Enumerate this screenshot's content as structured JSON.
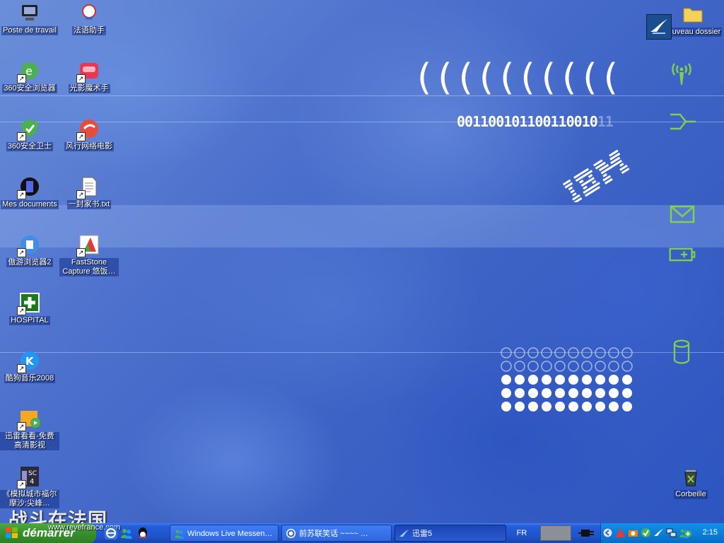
{
  "desktop": {
    "icons_left": [
      {
        "label": "Poste de travail",
        "icon": "my-computer-icon"
      },
      {
        "label": "法语助手",
        "icon": "french-assistant-icon"
      },
      {
        "label": "360安全浏览器",
        "icon": "360-browser-icon"
      },
      {
        "label": "光影魔术手",
        "icon": "photo-magic-icon"
      },
      {
        "label": "360安全卫士",
        "icon": "360-security-icon"
      },
      {
        "label": "风行网络电影",
        "icon": "funshion-icon"
      },
      {
        "label": "Mes documents",
        "icon": "my-documents-icon"
      },
      {
        "label": "一封家书.txt",
        "icon": "text-file-icon"
      },
      {
        "label": "傲游浏览器2",
        "icon": "maxthon-icon"
      },
      {
        "label": "FastStone Capture 悠饭…",
        "icon": "faststone-icon"
      },
      {
        "label": "HOSPITAL",
        "icon": "hospital-icon"
      },
      {
        "label": "酷狗音乐2008",
        "icon": "kugou-icon"
      },
      {
        "label": "迅雷看看-免费高清影视",
        "icon": "xunlei-kankan-icon"
      },
      {
        "label": "《模拟城市福尔摩沙:尖峰…",
        "icon": "simcity-icon"
      }
    ],
    "icons_right": [
      {
        "label": "uveau dossier",
        "icon": "folder-icon"
      },
      {
        "label": "Corbeille",
        "icon": "recycle-bin-icon"
      }
    ],
    "wallpaper": {
      "brackets": "((((((((((",
      "binary": "001100101100110010",
      "binary_faded": "11",
      "logo": "IBM",
      "colors": {
        "accent_green": "#7fd04a",
        "dot_white": "#ffffff",
        "background": "#3d63c6"
      }
    }
  },
  "taskbar": {
    "start_label": "démarrer",
    "watermark": "战斗在法国",
    "watermark_url": "www.revefrance.com",
    "quick_launch": [
      "show-desktop-icon",
      "ie-icon",
      "messenger-icon",
      "qq-icon"
    ],
    "tasks": [
      {
        "label": "Windows Live Messen…",
        "icon": "messenger-icon",
        "active": false
      },
      {
        "label": "前苏联笑话 ~~~~ …",
        "icon": "browser-icon",
        "active": false
      },
      {
        "label": "迅雷5",
        "icon": "xunlei-icon",
        "active": true
      }
    ],
    "language": "FR",
    "clock": "2:15"
  }
}
